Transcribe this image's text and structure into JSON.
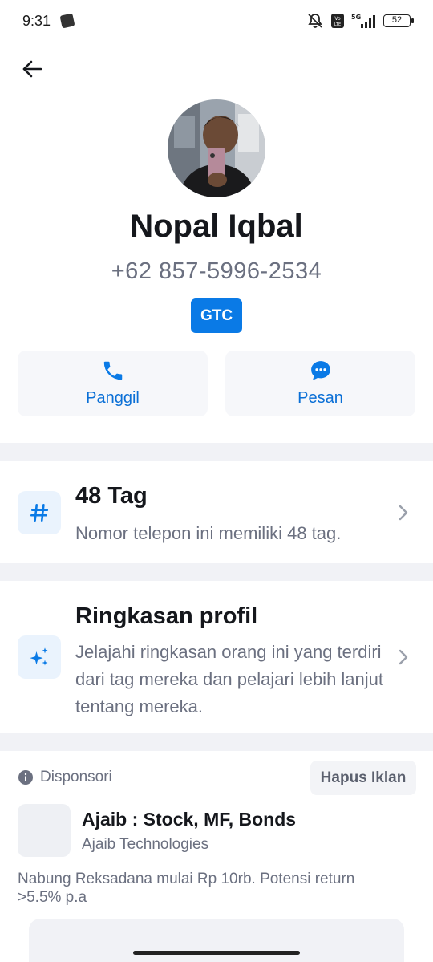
{
  "status_bar": {
    "time": "9:31",
    "network": "5G",
    "volte": "Vo LTE",
    "battery": "52"
  },
  "contact": {
    "name": "Nopal Iqbal",
    "phone": "+62 857-5996-2534",
    "badge": "GTC"
  },
  "actions": {
    "call_label": "Panggil",
    "message_label": "Pesan"
  },
  "tags": {
    "title": "48 Tag",
    "description": "Nomor telepon ini memiliki 48 tag."
  },
  "profile_summary": {
    "title": "Ringkasan profil",
    "description": "Jelajahi ringkasan orang ini yang terdiri dari tag mereka dan pelajari lebih lanjut tentang mereka."
  },
  "ad": {
    "sponsored_label": "Disponsori",
    "remove_label": "Hapus Iklan",
    "title": "Ajaib : Stock, MF, Bonds",
    "company": "Ajaib Technologies",
    "description": "Nabung Reksadana mulai Rp 10rb. Potensi return >5.5% p.a"
  },
  "colors": {
    "accent": "#0a7ae6",
    "link": "#0a6fd6",
    "secondary_text": "#6b7080",
    "divider": "#f1f2f6"
  }
}
